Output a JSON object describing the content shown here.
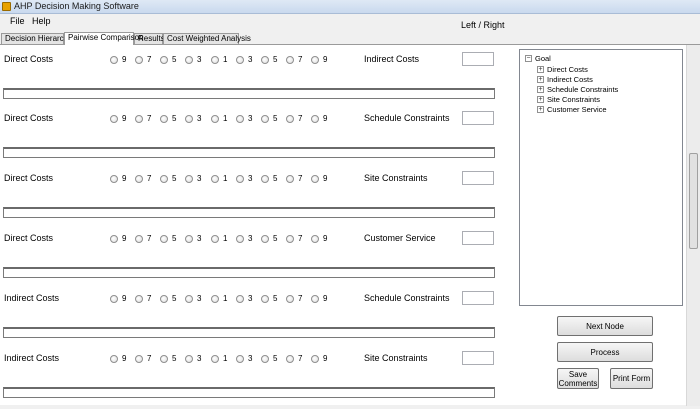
{
  "window": {
    "title": "AHP Decision Making Software"
  },
  "menu": {
    "items": [
      "File",
      "Help"
    ]
  },
  "header": {
    "left_right_label": "Left / Right"
  },
  "tabs": [
    "Decision Hierarchy",
    "Pairwise Comparison",
    "Results",
    "Cost Weighted Analysis"
  ],
  "active_tab": "Pairwise Comparison",
  "scale_options": [
    "9",
    "7",
    "5",
    "3",
    "1",
    "3",
    "5",
    "7",
    "9"
  ],
  "comparisons": [
    {
      "left": "Direct Costs",
      "right": "Indirect Costs"
    },
    {
      "left": "Direct Costs",
      "right": "Schedule Constraints"
    },
    {
      "left": "Direct Costs",
      "right": "Site Constraints"
    },
    {
      "left": "Direct Costs",
      "right": "Customer Service"
    },
    {
      "left": "Indirect Costs",
      "right": "Schedule Constraints"
    },
    {
      "left": "Indirect Costs",
      "right": "Site Constraints"
    }
  ],
  "tree": {
    "root": "Goal",
    "children": [
      "Direct Costs",
      "Indirect Costs",
      "Schedule Constraints",
      "Site Constraints",
      "Customer Service"
    ]
  },
  "buttons": {
    "next_node": "Next Node",
    "process": "Process",
    "save_comments_line1": "Save",
    "save_comments_line2": "Comments",
    "print_form": "Print Form"
  }
}
